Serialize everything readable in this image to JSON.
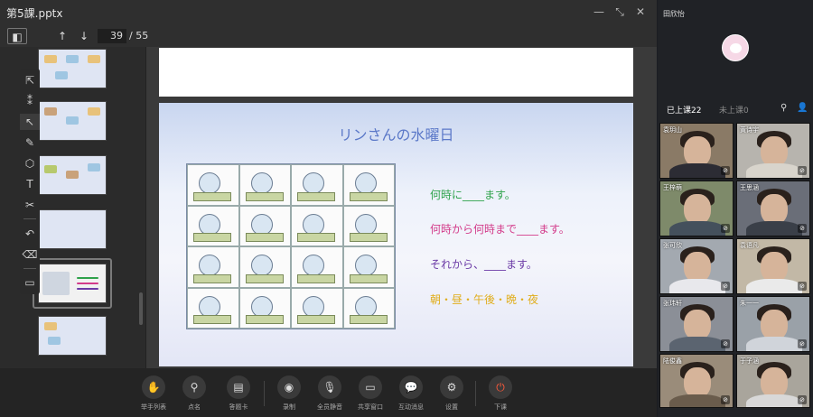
{
  "window": {
    "title": "第5課.pptx",
    "minimize": "—",
    "restore": "⤡",
    "close": "✕"
  },
  "toolbar": {
    "sidebar_icon": "◧",
    "prev_icon": "↑",
    "next_icon": "↓",
    "current_page": "39",
    "total_pages": "/ 55"
  },
  "tools": [
    "⇱",
    "⁑",
    "↖",
    "✎",
    "⬡",
    "T",
    "✂",
    "↶",
    "⌫",
    "▭"
  ],
  "slide": {
    "title": "リンさんの水曜日",
    "lines": [
      "何時に____ます。",
      "何時から何時まで____ます。",
      "それから、____ます。",
      "朝・昼・午後・晩・夜"
    ]
  },
  "bottombar": {
    "items": [
      {
        "label": "举手列表",
        "icon": "✋"
      },
      {
        "label": "点名",
        "icon": "⚲"
      },
      {
        "label": "答题卡",
        "icon": "▤"
      },
      {
        "label": "录制",
        "icon": "◉"
      },
      {
        "label": "全员静音",
        "icon": "🎙"
      },
      {
        "label": "共享窗口",
        "icon": "▭"
      },
      {
        "label": "互动消息",
        "icon": "💬"
      },
      {
        "label": "设置",
        "icon": "⚙"
      },
      {
        "label": "下课",
        "icon": "⏻"
      }
    ]
  },
  "participants_panel": {
    "host_name": "田欣怡",
    "tab_joined": "已上课22",
    "tab_not_joined": "未上课0",
    "search_icon": "⚲",
    "person_icon": "👤",
    "tiles": [
      {
        "name": "袁玥山"
      },
      {
        "name": "黄诗宇"
      },
      {
        "name": "王梓萌"
      },
      {
        "name": "王思涵"
      },
      {
        "name": "张可欣"
      },
      {
        "name": "袁语凡"
      },
      {
        "name": "张玮轩"
      },
      {
        "name": "朱一一"
      },
      {
        "name": "陆俊鑫"
      },
      {
        "name": "于子涵"
      }
    ]
  }
}
